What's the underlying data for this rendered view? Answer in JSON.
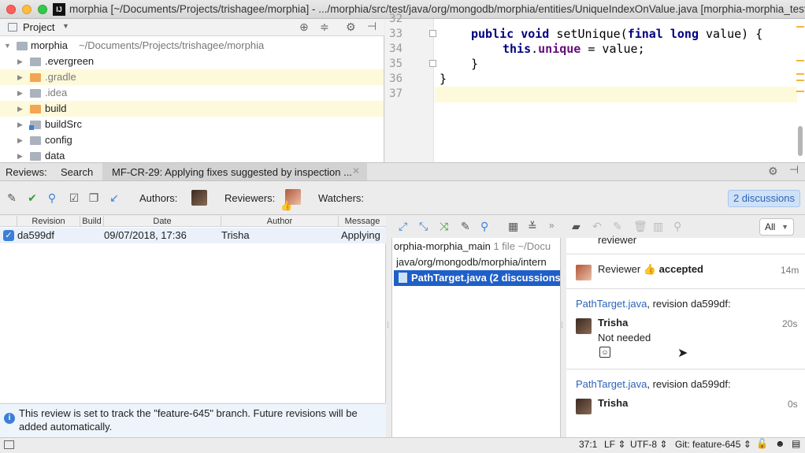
{
  "window": {
    "title": "morphia [~/Documents/Projects/trishagee/morphia] - .../morphia/src/test/java/org/mongodb/morphia/entities/UniqueIndexOnValue.java [morphia-morphia_test]",
    "app_icon": "IJ"
  },
  "project": {
    "header": "Project",
    "root_name": "morphia",
    "root_path": "~/Documents/Projects/trishagee/morphia",
    "items": [
      {
        "label": ".evergreen",
        "icon": "folder-gray"
      },
      {
        "label": ".gradle",
        "icon": "folder-orange"
      },
      {
        "label": ".idea",
        "icon": "folder-gray"
      },
      {
        "label": "build",
        "icon": "folder-orange"
      },
      {
        "label": "buildSrc",
        "icon": "folder-module"
      },
      {
        "label": "config",
        "icon": "folder-gray"
      },
      {
        "label": "data",
        "icon": "folder-gray"
      }
    ]
  },
  "editor": {
    "line_numbers": [
      "32",
      "33",
      "34",
      "35",
      "36",
      "37"
    ],
    "lines": {
      "l33_kw1": "public",
      "l33_kw2": "void",
      "l33_method": " setUnique(",
      "l33_kw3": "final",
      "l33_kw4": "long",
      "l33_rest": " value) {",
      "l34_kw": "this",
      "l34_dot": ".",
      "l34_field": "unique",
      "l34_rest": " = value;",
      "l35": "}",
      "l36": "}"
    }
  },
  "reviews": {
    "tabs": {
      "reviews": "Reviews:",
      "search": "Search",
      "active": "MF-CR-29: Applying fixes suggested by inspection ..."
    },
    "toolbar": {
      "authors": "Authors:",
      "reviewers": "Reviewers:",
      "watchers": "Watchers:",
      "discussions_button": "2 discussions"
    },
    "table": {
      "columns": [
        "Revision",
        "Build",
        "Date",
        "Author",
        "Message"
      ],
      "rows": [
        {
          "revision": "da599df",
          "build": "",
          "date": "09/07/2018, 17:36",
          "author": "Trisha",
          "message": "Applying"
        }
      ]
    },
    "info_text": "This review is set to track the \"feature-645\" branch. Future revisions will be added automatically."
  },
  "files": {
    "module": "orphia-morphia_main",
    "module_count": "1 file",
    "module_path": "~/Docu",
    "path": "java/org/mongodb/morphia/intern",
    "selected_file": "PathTarget.java (2 discussions)"
  },
  "discussion": {
    "filter": "All",
    "top_partial": "reviewer",
    "event": {
      "who": "Reviewer",
      "action": "accepted",
      "time": "14m"
    },
    "threads": [
      {
        "file_link": "PathTarget.java",
        "revision_text": ", revision da599df:",
        "author": "Trisha",
        "time": "20s",
        "text": "Not needed"
      },
      {
        "file_link": "PathTarget.java",
        "revision_text": ", revision da599df:",
        "author": "Trisha",
        "time": "0s",
        "text": ""
      }
    ]
  },
  "status": {
    "position": "37:1",
    "line_sep": "LF",
    "encoding": "UTF-8",
    "vcs": "Git: feature-645"
  },
  "colors": {
    "accent": "#2d63b8",
    "selection": "#1f5fc8",
    "highlight_line": "#fdf9db"
  }
}
